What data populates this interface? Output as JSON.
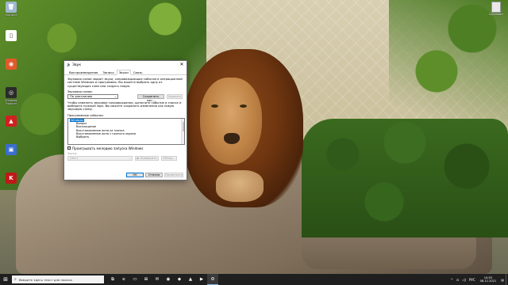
{
  "desktop": {
    "icons": [
      {
        "label": "Корзина",
        "name": "recycle-bin",
        "color": "#9fb8d0",
        "glyph": "🗑"
      },
      {
        "label": "",
        "name": "document",
        "color": "#ffffff",
        "glyph": "▯"
      },
      {
        "label": "",
        "name": "app-1",
        "color": "#e05a2b",
        "glyph": "◉"
      },
      {
        "label": "Windows Explorer",
        "name": "explorer",
        "color": "#2b2b2b",
        "glyph": "◎"
      },
      {
        "label": "",
        "name": "app-2",
        "color": "#d02020",
        "glyph": "▲"
      },
      {
        "label": "",
        "name": "app-3",
        "color": "#3a6fd0",
        "glyph": "▣"
      },
      {
        "label": "",
        "name": "app-4",
        "color": "#c01818",
        "glyph": "K"
      }
    ],
    "top_right_icon_label": "Скриншот"
  },
  "dialog": {
    "title": "Звук",
    "tabs": [
      "Воспроизведение",
      "Запись",
      "Звуки",
      "Связь"
    ],
    "active_tab_index": 2,
    "description": "Звуковая схема задает звуки, сопровождающие события в операционной системе Windows и программах. Вы можете выбрать одну из существующих схем или создать новую.",
    "scheme_label": "Звуковая схема:",
    "scheme_value": "По умолчанию",
    "save_as_label": "Сохранить как...",
    "delete_label": "Удалить",
    "events_description": "Чтобы изменить звуковое сопровождение, щелкните событие в списке и выберите нужный звук. Вы можете сохранить изменения как новую звуковую схему.",
    "events_label": "Программные события:",
    "events": [
      {
        "label": "Windows",
        "selected": true,
        "indent": 0
      },
      {
        "label": "Вопрос",
        "selected": false,
        "indent": 1
      },
      {
        "label": "Восклицание",
        "selected": false,
        "indent": 1
      },
      {
        "label": "Восстановление окна из значка",
        "selected": false,
        "indent": 1
      },
      {
        "label": "Восстановление окна с полного экрана",
        "selected": false,
        "indent": 1
      },
      {
        "label": "Выбрать",
        "selected": false,
        "indent": 1
      }
    ],
    "startup_checkbox_label": "Проигрывать мелодию запуска Windows",
    "sounds_label": "Звуки:",
    "sounds_value": "(Нет)",
    "test_label": "▶ Проверить",
    "browse_label": "Обзор...",
    "ok_label": "ОК",
    "cancel_label": "Отмена",
    "apply_label": "Применить"
  },
  "taskbar": {
    "search_placeholder": "Введите здесь текст для поиска",
    "icons": [
      {
        "name": "task-view-icon",
        "glyph": "⧉"
      },
      {
        "name": "edge-icon",
        "glyph": "e"
      },
      {
        "name": "file-explorer-icon",
        "glyph": "▭"
      },
      {
        "name": "store-icon",
        "glyph": "⊞"
      },
      {
        "name": "mail-icon",
        "glyph": "✉"
      },
      {
        "name": "chrome-icon",
        "glyph": "◉"
      },
      {
        "name": "app-icon-1",
        "glyph": "◆"
      },
      {
        "name": "app-icon-2",
        "glyph": "▲"
      },
      {
        "name": "app-icon-3",
        "glyph": "▶"
      },
      {
        "name": "settings-icon",
        "glyph": "⚙"
      }
    ],
    "tray": {
      "chevron": "^",
      "network": "⊡",
      "volume": "◁)",
      "language": "РУС",
      "time": "14:55",
      "date": "08.12.2021",
      "notifications": "▤"
    }
  }
}
